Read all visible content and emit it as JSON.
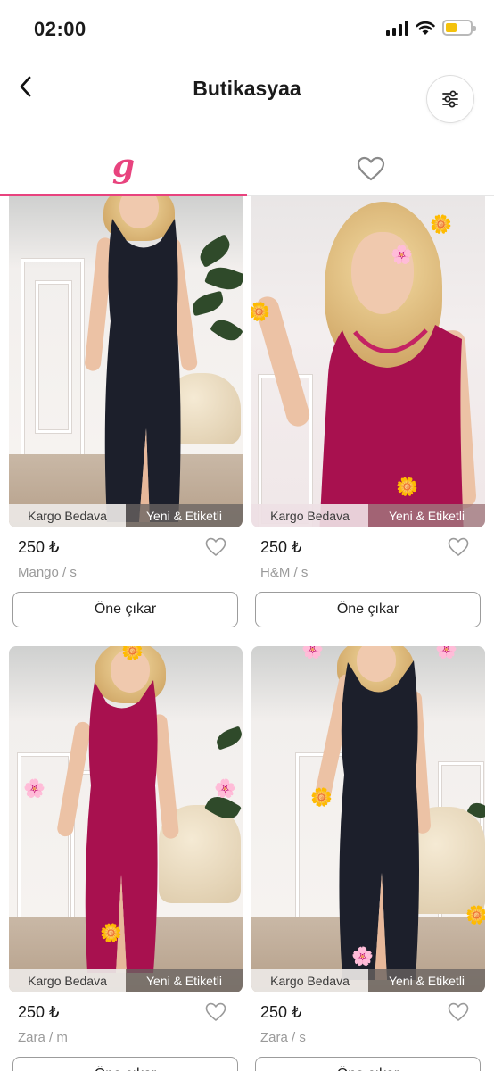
{
  "status_bar": {
    "time": "02:00"
  },
  "header": {
    "title": "Butikasyaa"
  },
  "tabs": [
    {
      "label": "g",
      "active": true
    },
    {
      "icon": "heart-outline-icon",
      "active": false
    }
  ],
  "accent_color": "#e8437e",
  "products": [
    {
      "price": "250 ₺",
      "meta": "Mango / s",
      "badge_cargo": "Kargo Bedava",
      "badge_new": "Yeni & Etiketli",
      "button": "Öne çıkar",
      "dress_color": "#1c1f2b"
    },
    {
      "price": "250 ₺",
      "meta": "H&M / s",
      "badge_cargo": "Kargo Bedava",
      "badge_new": "Yeni & Etiketli",
      "button": "Öne çıkar",
      "dress_color": "#a8114f"
    },
    {
      "price": "250 ₺",
      "meta": "Zara / m",
      "badge_cargo": "Kargo Bedava",
      "badge_new": "Yeni & Etiketli",
      "button": "Öne çıkar",
      "dress_color": "#a8114f"
    },
    {
      "price": "250 ₺",
      "meta": "Zara / s",
      "badge_cargo": "Kargo Bedava",
      "badge_new": "Yeni & Etiketli",
      "button": "Öne çıkar",
      "dress_color": "#1c1f2b"
    }
  ]
}
